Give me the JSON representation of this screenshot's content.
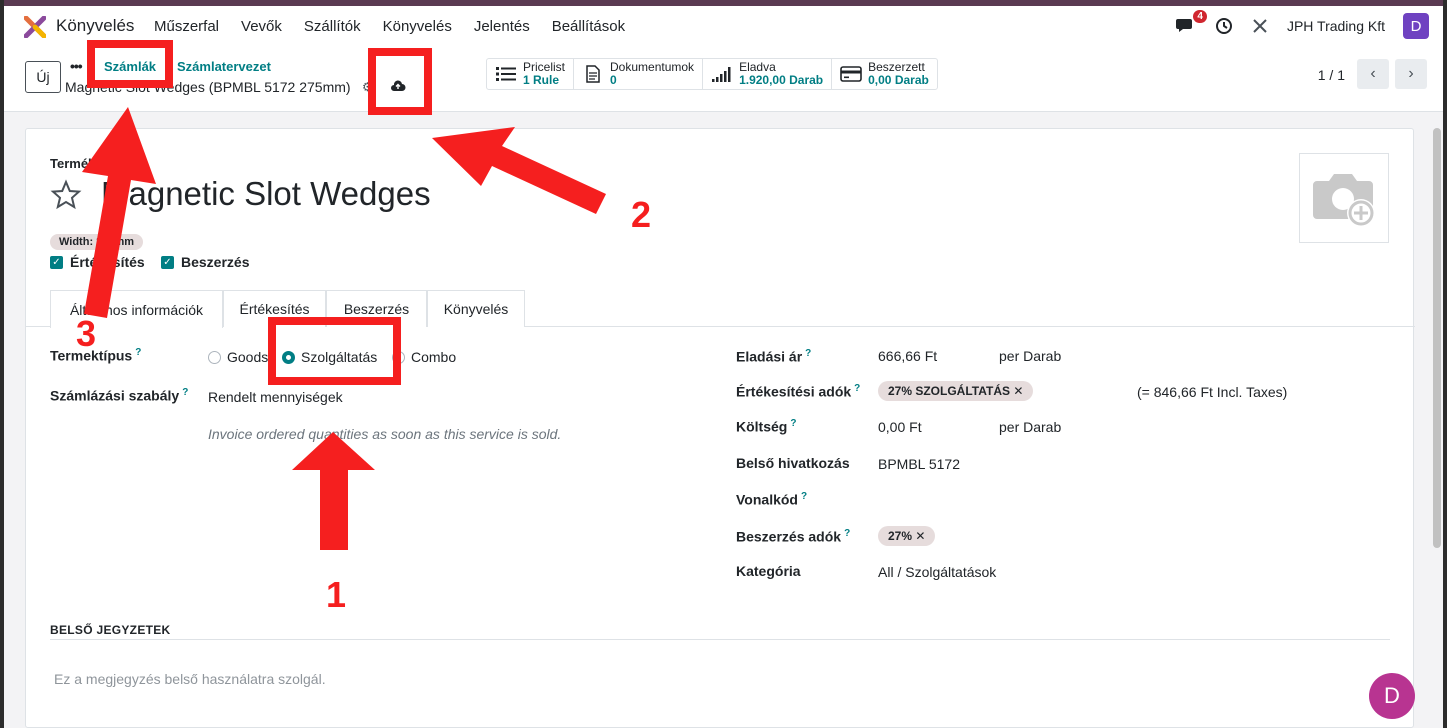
{
  "app": {
    "name": "Könyvelés",
    "menu": [
      "Műszerfal",
      "Vevők",
      "Szállítók",
      "Könyvelés",
      "Jelentés",
      "Beállítások"
    ],
    "notification_count": "4",
    "company": "JPH Trading Kft",
    "user_initial": "D"
  },
  "control": {
    "new_label": "Új",
    "more_label": "•••",
    "breadcrumb_parent": "Számlák",
    "breadcrumb_sep": "/",
    "breadcrumb_current": "Számlatervezet",
    "record_title": "Magnetic Slot Wedges (BPMBL 5172 275mm)",
    "pager_text": "1 / 1"
  },
  "stats": [
    {
      "label": "Pricelist",
      "value": "1 Rule",
      "icon": "list-icon"
    },
    {
      "label": "Dokumentumok",
      "value": "0",
      "icon": "document-icon"
    },
    {
      "label": "Eladva",
      "value": "1.920,00 Darab",
      "icon": "bar-chart-icon"
    },
    {
      "label": "Beszerzett",
      "value": "0,00 Darab",
      "icon": "credit-card-icon"
    }
  ],
  "product": {
    "top_label": "Termék",
    "name": "Magnetic Slot Wedges",
    "tag": "Width: 275mm",
    "checkbox_sales": "Értékesítés",
    "checkbox_purchase": "Beszerzés"
  },
  "tabs": [
    "Általános információk",
    "Értékesítés",
    "Beszerzés",
    "Könyvelés"
  ],
  "general": {
    "product_type_label": "Termektípus",
    "type_options": [
      "Goods",
      "Szolgáltatás",
      "Combo"
    ],
    "invoice_policy_label": "Számlázási szabály",
    "invoice_policy_value": "Rendelt mennyiségek",
    "invoice_hint": "Invoice ordered quantities as soon as this service is sold.",
    "sale_price_label": "Eladási ár",
    "sale_price_value": "666,66 Ft",
    "sale_price_unit": "per Darab",
    "sales_tax_label": "Értékesítési adók",
    "sales_tax_value": "27% SZOLGÁLTATÁS",
    "sales_tax_incl": "(= 846,66 Ft Incl. Taxes)",
    "cost_label": "Költség",
    "cost_value": "0,00 Ft",
    "cost_unit": "per Darab",
    "internal_ref_label": "Belső hivatkozás",
    "internal_ref_value": "BPMBL 5172",
    "barcode_label": "Vonalkód",
    "purchase_tax_label": "Beszerzés adók",
    "purchase_tax_value": "27%",
    "category_label": "Kategória",
    "category_value": "All / Szolgáltatások"
  },
  "notes": {
    "heading": "BELSŐ JEGYZETEK",
    "placeholder": "Ez a megjegyzés belső használatra szolgál."
  },
  "annotations": {
    "num1": "1",
    "num2": "2",
    "num3": "3",
    "color": "#f51f1f"
  },
  "colors": {
    "accent": "#017e84",
    "brand_top": "#5a3a52",
    "avatar": "#6f42c1",
    "fab": "#b83491"
  }
}
